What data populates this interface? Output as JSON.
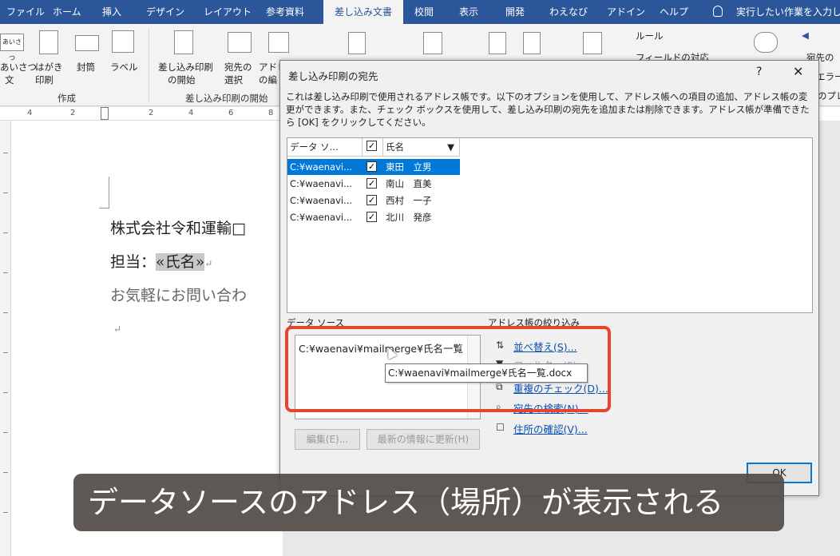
{
  "tabs": [
    "ファイル",
    "ホーム",
    "挿入",
    "デザイン",
    "レイアウト",
    "参考資料",
    "差し込み文書",
    "校閲",
    "表示",
    "開発",
    "わえなび",
    "アドイン",
    "ヘルプ"
  ],
  "tell_me": "実行したい作業を入力し",
  "ribbon": {
    "greeting_l1": "あいさつ",
    "greeting_l2": "文",
    "postcard_l1": "はがき",
    "postcard_l2": "印刷",
    "envelope": "封筒",
    "label": "ラベル",
    "start_merge_l1": "差し込み印刷",
    "start_merge_l2": "の開始",
    "select_recipients_l1": "宛先の",
    "select_recipients_l2": "選択",
    "edit_list_l1": "アドレ",
    "edit_list_l2": "の編",
    "rules": "ルール",
    "match_fields": "フィールドの対応",
    "group_create": "作成",
    "group_start": "差し込み印刷の開始",
    "right_text1": "宛先の",
    "right_text2": "エラー",
    "right_text3": "のプレ"
  },
  "ruler_numbers": [
    "4",
    "2",
    "2",
    "4",
    "6",
    "8"
  ],
  "document": {
    "line1": "株式会社令和運輸",
    "line1_mark": "□",
    "line2_prefix": "担当：",
    "line2_field": "«氏名»",
    "line3": "お気軽にお問い合わ",
    "return_mark": "↵"
  },
  "dialog": {
    "title": "差し込み印刷の宛先",
    "help": "?",
    "close": "✕",
    "description": "これは差し込み印刷で使用されるアドレス帳です。以下のオプションを使用して、アドレス帳への項目の追加、アドレス帳の変更ができます。また、チェック ボックスを使用して、差し込み印刷の宛先を追加または削除できます。アドレス帳が準備できたら [OK] をクリックしてください。",
    "columns": {
      "source": "データ ソ...",
      "check": "✓",
      "name": "氏名"
    },
    "rows": [
      {
        "source": "C:¥waenavi...",
        "checked": "✓",
        "name": "東田　立男"
      },
      {
        "source": "C:¥waenavi...",
        "checked": "✓",
        "name": "南山　直美"
      },
      {
        "source": "C:¥waenavi...",
        "checked": "✓",
        "name": "西村　一子"
      },
      {
        "source": "C:¥waenavi...",
        "checked": "✓",
        "name": "北川　発彦"
      }
    ],
    "data_source_label": "データ ソース",
    "data_source_item": "C:¥waenavi¥mailmerge¥氏名一覧",
    "refine_label": "アドレス帳の絞り込み",
    "links": {
      "sort": "並べ替え(S)...",
      "filter": "フィルター(F)...",
      "duplicates": "重複のチェック(D)...",
      "find": "宛先の検索(N)...",
      "validate": "住所の確認(V)..."
    },
    "edit_button": "編集(E)...",
    "refresh_button": "最新の情報に更新(H)",
    "ok_button": "OK"
  },
  "tooltip": "C:¥waenavi¥mailmerge¥氏名一覧.docx",
  "caption": "データソースのアドレス（場所）が表示される",
  "colors": {
    "ribbon_blue": "#2b579a",
    "highlight_red": "#e8442d",
    "selection_blue": "#0078d7",
    "link_blue": "#0a4fb3"
  }
}
